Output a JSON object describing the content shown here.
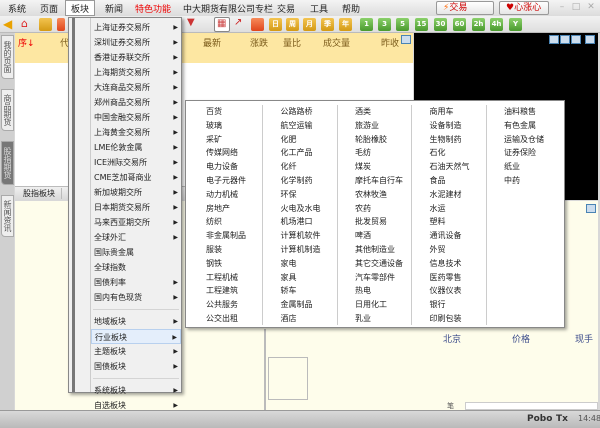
{
  "menubar": {
    "items": [
      "系统",
      "页面",
      "板块",
      "新闻",
      "特色功能",
      "中大期货有限公司专栏",
      "交易",
      "工具",
      "帮助"
    ],
    "trade_button": "交易",
    "xinzhangxin_button": "心涨心",
    "win_controls": [
      "–",
      "□",
      "✕"
    ]
  },
  "toolbar": {
    "period_buttons": [
      "▦",
      "日",
      "周",
      "月",
      "季",
      "年"
    ],
    "minute_buttons": [
      "1",
      "3",
      "5",
      "15",
      "30",
      "60",
      "2h",
      "4h",
      "Y"
    ]
  },
  "side_tabs": [
    "我的页面",
    "商品期货",
    "股指期货",
    "新闻资讯"
  ],
  "quote_header": {
    "columns": [
      "序↓",
      "代",
      "最新",
      "涨跌",
      "量比",
      "成交量",
      "昨收"
    ]
  },
  "tab_bar": {
    "tab": "股指板块"
  },
  "bottom_panel": {
    "labels": [
      "北京",
      "价格",
      "现手"
    ],
    "input_label": "笔"
  },
  "statusbar": {
    "brand": "Pobo",
    "signal": "Tx",
    "time": "14:48"
  },
  "menu1": {
    "group1": [
      "上海证券交易所",
      "深圳证券交易所",
      "香港证券联交所",
      "上海期货交易所",
      "大连商品交易所",
      "郑州商品交易所",
      "中国金融交易所",
      "上海黄金交易所",
      "LME伦敦金属",
      "ICE洲际交易所",
      "CME芝加哥商业",
      "新加坡期交所",
      "日本期货交易所",
      "马来西亚期交所",
      "全球外汇",
      "国际贵金属",
      "全球指数",
      "国债利率",
      "国内有色现货"
    ],
    "group1_arrows": [
      1,
      1,
      1,
      1,
      1,
      1,
      1,
      1,
      1,
      1,
      1,
      1,
      1,
      1,
      1,
      0,
      0,
      1,
      1
    ],
    "group2": [
      "地域板块",
      "行业板块",
      "主题板块",
      "国债板块"
    ],
    "group3": [
      "系统板块",
      "自选板块"
    ],
    "highlighted": "行业板块"
  },
  "industry_submenu": {
    "columns": [
      [
        "百货",
        "玻璃",
        "采矿",
        "传媒网络",
        "电力设备",
        "电子元器件",
        "动力机械",
        "房地产",
        "纺织",
        "非金属制品",
        "服装",
        "钢铁",
        "工程机械",
        "工程建筑",
        "公共服务",
        "公交出租"
      ],
      [
        "公路路桥",
        "航空运输",
        "化肥",
        "化工产品",
        "化纤",
        "化学制药",
        "环保",
        "火电及水电",
        "机场港口",
        "计算机软件",
        "计算机制造",
        "家电",
        "家具",
        "轿车",
        "金属制品",
        "酒店"
      ],
      [
        "酒类",
        "旅游业",
        "轮胎橡胶",
        "毛纺",
        "煤炭",
        "摩托车自行车",
        "农林牧渔",
        "农药",
        "批发贸易",
        "啤酒",
        "其他制造业",
        "其它交通设备",
        "汽车零部件",
        "热电",
        "日用化工",
        "乳业"
      ],
      [
        "商用车",
        "设备制造",
        "生物制药",
        "石化",
        "石油天然气",
        "食品",
        "水泥建材",
        "水运",
        "塑料",
        "通讯设备",
        "外贸",
        "信息技术",
        "医药零售",
        "仪器仪表",
        "银行",
        "印刷包装"
      ],
      [
        "油料粮售",
        "有色金属",
        "运输及仓储",
        "证券保险",
        "纸业",
        "中药"
      ]
    ]
  }
}
